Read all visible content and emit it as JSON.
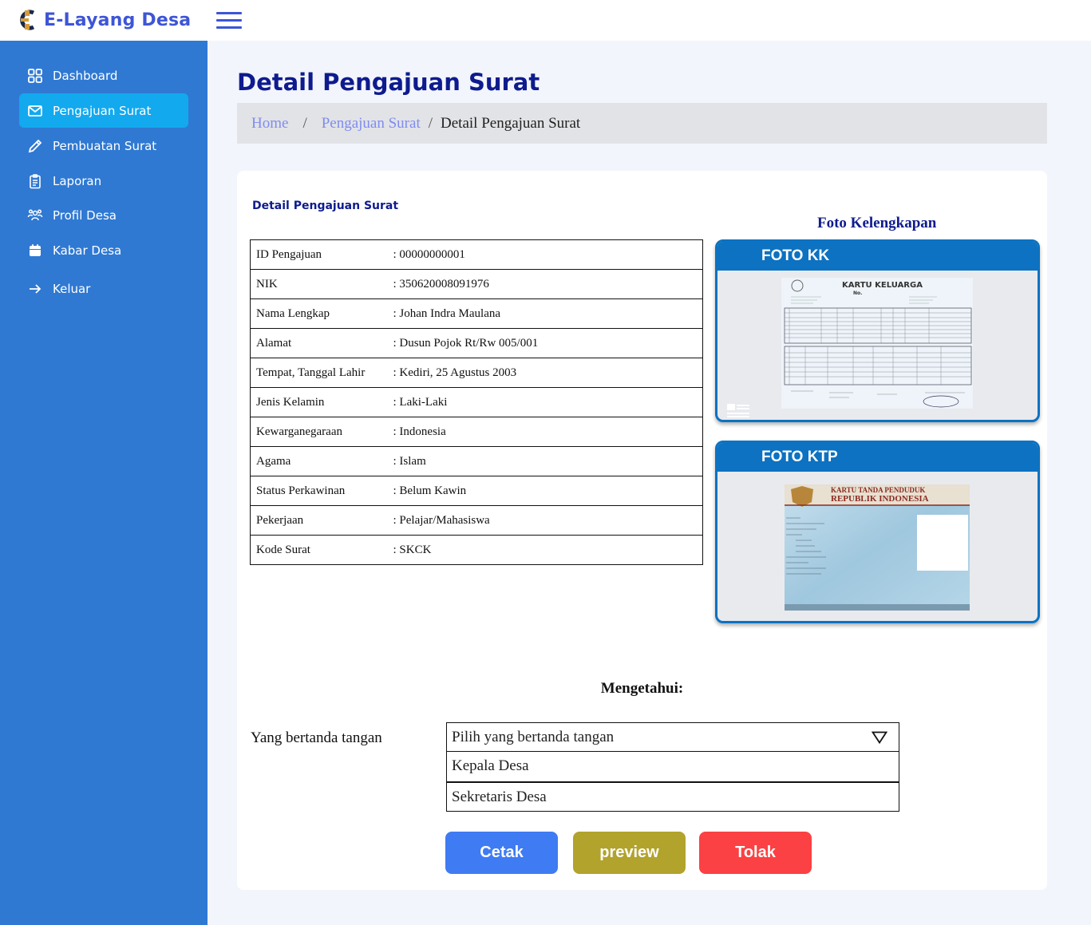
{
  "app": {
    "title": "E-Layang Desa"
  },
  "sidebar": {
    "items": [
      {
        "label": "Dashboard",
        "icon": "grid-icon",
        "active": false
      },
      {
        "label": "Pengajuan Surat",
        "icon": "mail-icon",
        "active": true
      },
      {
        "label": "Pembuatan Surat",
        "icon": "pencil-icon",
        "active": false
      },
      {
        "label": "Laporan",
        "icon": "clipboard-icon",
        "active": false
      },
      {
        "label": "Profil Desa",
        "icon": "people-icon",
        "active": false
      },
      {
        "label": "Kabar Desa",
        "icon": "calendar-icon",
        "active": false
      },
      {
        "label": "Keluar",
        "icon": "arrow-right-icon",
        "active": false
      }
    ]
  },
  "page": {
    "title": "Detail Pengajuan Surat",
    "breadcrumb": {
      "home": "Home",
      "sep": "/",
      "parent": "Pengajuan Surat",
      "current": "Detail Pengajuan Surat"
    }
  },
  "card": {
    "title": "Detail Pengajuan Surat",
    "details": [
      {
        "label": "ID Pengajuan",
        "value": ": 00000000001"
      },
      {
        "label": "NIK",
        "value": ": 350620008091976"
      },
      {
        "label": "Nama Lengkap",
        "value": ": Johan Indra Maulana"
      },
      {
        "label": "Alamat",
        "value": ": Dusun Pojok Rt/Rw 005/001"
      },
      {
        "label": "Tempat, Tanggal Lahir",
        "value": ": Kediri, 25 Agustus 2003"
      },
      {
        "label": "Jenis Kelamin",
        "value": ": Laki-Laki"
      },
      {
        "label": "Kewarganegaraan",
        "value": ": Indonesia"
      },
      {
        "label": "Agama",
        "value": ": Islam"
      },
      {
        "label": "Status Perkawinan",
        "value": ": Belum Kawin"
      },
      {
        "label": "Pekerjaan",
        "value": ": Pelajar/Mahasiswa"
      },
      {
        "label": "Kode Surat",
        "value": ": SKCK"
      }
    ],
    "foto": {
      "heading": "Foto Kelengkapan",
      "kk_label": "FOTO KK",
      "ktp_label": "FOTO KTP",
      "kk_doc": {
        "title": "KARTU KELUARGA",
        "no": "No."
      },
      "ktp_doc": {
        "line1": "KARTU TANDA PENDUDUK",
        "line2": "REPUBLIK INDONESIA"
      }
    },
    "sign": {
      "heading": "Mengetahui:",
      "label": "Yang bertanda tangan",
      "placeholder": "Pilih yang bertanda tangan",
      "options": [
        "Kepala Desa",
        "Sekretaris Desa"
      ]
    },
    "buttons": {
      "cetak": "Cetak",
      "preview": "preview",
      "tolak": "Tolak"
    }
  },
  "colors": {
    "sidebar": "#2f79d3",
    "active": "#12a9ef",
    "title": "#0e1b8e",
    "cetak": "#3f7bf3",
    "preview": "#b1a32c",
    "tolak": "#fb4143"
  }
}
